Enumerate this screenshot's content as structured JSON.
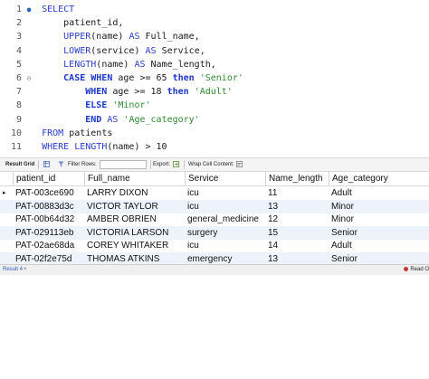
{
  "editor": {
    "lines": [
      {
        "num": "1",
        "marker": "dot",
        "parts": [
          [
            "kw",
            "    SELECT"
          ]
        ]
      },
      {
        "num": "2",
        "marker": "",
        "parts": [
          [
            "op",
            "        patient_id,"
          ]
        ]
      },
      {
        "num": "3",
        "marker": "",
        "parts": [
          [
            "fn",
            "        UPPER"
          ],
          [
            "op",
            "(name) "
          ],
          [
            "kw",
            "AS"
          ],
          [
            "op",
            " Full_name,"
          ]
        ]
      },
      {
        "num": "4",
        "marker": "",
        "parts": [
          [
            "fn",
            "        LOWER"
          ],
          [
            "op",
            "(service) "
          ],
          [
            "kw",
            "AS"
          ],
          [
            "op",
            " Service,"
          ]
        ]
      },
      {
        "num": "5",
        "marker": "",
        "parts": [
          [
            "fn",
            "        LENGTH"
          ],
          [
            "op",
            "(name) "
          ],
          [
            "kw",
            "AS"
          ],
          [
            "op",
            " Name_length,"
          ]
        ]
      },
      {
        "num": "6",
        "marker": "fold",
        "parts": [
          [
            "kwb",
            "        CASE WHEN"
          ],
          [
            "op",
            " age >= 65 "
          ],
          [
            "kwb",
            "then"
          ],
          [
            "op",
            " "
          ],
          [
            "str",
            "'Senior'"
          ]
        ]
      },
      {
        "num": "7",
        "marker": "",
        "parts": [
          [
            "kwb",
            "            WHEN"
          ],
          [
            "op",
            " age >= 18 "
          ],
          [
            "kwb",
            "then"
          ],
          [
            "op",
            " "
          ],
          [
            "str",
            "'Adult'"
          ]
        ]
      },
      {
        "num": "8",
        "marker": "",
        "parts": [
          [
            "kwb",
            "            ELSE"
          ],
          [
            "op",
            " "
          ],
          [
            "str",
            "'Minor'"
          ]
        ]
      },
      {
        "num": "9",
        "marker": "",
        "parts": [
          [
            "kwb",
            "            END"
          ],
          [
            "op",
            " "
          ],
          [
            "kw",
            "AS"
          ],
          [
            "op",
            " "
          ],
          [
            "str",
            "'Age_category'"
          ]
        ]
      },
      {
        "num": "10",
        "marker": "",
        "parts": [
          [
            "kw",
            "    FROM"
          ],
          [
            "op",
            " patients"
          ]
        ]
      },
      {
        "num": "11",
        "marker": "",
        "parts": [
          [
            "kw",
            "    WHERE"
          ],
          [
            "op",
            " "
          ],
          [
            "fn",
            "LENGTH"
          ],
          [
            "op",
            "(name) > 10"
          ]
        ]
      }
    ]
  },
  "toolbar": {
    "result_grid": "Result Grid",
    "filter_rows": "Filter Rows:",
    "export": "Export:",
    "wrap": "Wrap Cell Content:"
  },
  "grid": {
    "columns": [
      "patient_id",
      "Full_name",
      "Service",
      "Name_length",
      "Age_category"
    ],
    "rows": [
      [
        "PAT-003ce690",
        "LARRY DIXON",
        "icu",
        "11",
        "Adult"
      ],
      [
        "PAT-00883d3c",
        "VICTOR TAYLOR",
        "icu",
        "13",
        "Minor"
      ],
      [
        "PAT-00b64d32",
        "AMBER OBRIEN",
        "general_medicine",
        "12",
        "Minor"
      ],
      [
        "PAT-029113eb",
        "VICTORIA LARSON",
        "surgery",
        "15",
        "Senior"
      ],
      [
        "PAT-02ae68da",
        "COREY WHITAKER",
        "icu",
        "14",
        "Adult"
      ],
      [
        "PAT-02f2e75d",
        "THOMAS ATKINS",
        "emergency",
        "13",
        "Senior"
      ]
    ]
  },
  "tabs": {
    "result_tab": "Result 4",
    "close": "×",
    "read_only": "Read O"
  }
}
